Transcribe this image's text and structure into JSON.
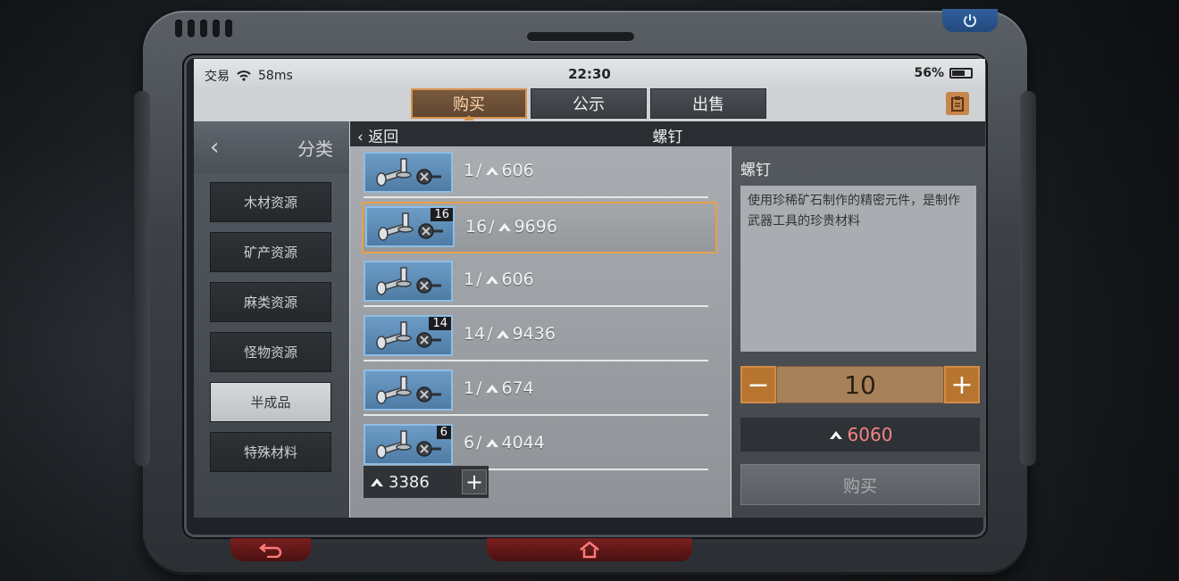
{
  "status": {
    "app": "交易",
    "ping": "58ms",
    "time": "22:30",
    "battery": "56%"
  },
  "tabs": [
    {
      "label": "购买",
      "active": true
    },
    {
      "label": "公示",
      "active": false
    },
    {
      "label": "出售",
      "active": false
    }
  ],
  "sidebar": {
    "title": "分类",
    "items": [
      "木材资源",
      "矿产资源",
      "麻类资源",
      "怪物资源",
      "半成品",
      "特殊材料"
    ],
    "selected_index": 4
  },
  "header": {
    "back_label": "返回",
    "title": "螺钉"
  },
  "listings": [
    {
      "badge": "",
      "qty": "1",
      "price": "606"
    },
    {
      "badge": "16",
      "qty": "16",
      "price": "9696"
    },
    {
      "badge": "",
      "qty": "1",
      "price": "606"
    },
    {
      "badge": "14",
      "qty": "14",
      "price": "9436"
    },
    {
      "badge": "",
      "qty": "1",
      "price": "674"
    },
    {
      "badge": "6",
      "qty": "6",
      "price": "4044"
    }
  ],
  "selected_listing": 1,
  "balance": "3386",
  "detail": {
    "name": "螺钉",
    "description": "使用珍稀矿石制作的精密元件，是制作武器工具的珍贵材料",
    "quantity": "10",
    "total": "6060",
    "buy_label": "购买"
  },
  "colors": {
    "accent": "#d7934f",
    "price_red": "#f28585",
    "thumb_blue": "#5d8cb6"
  }
}
